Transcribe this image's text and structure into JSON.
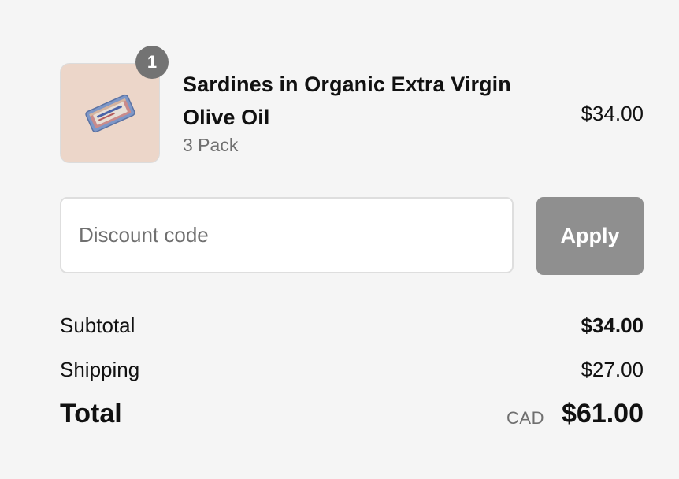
{
  "product": {
    "quantity": "1",
    "title": "Sardines in Organic Extra Virgin Olive Oil",
    "variant": "3 Pack",
    "price": "$34.00",
    "image_icon": "sardine-tin-icon"
  },
  "discount": {
    "placeholder": "Discount code",
    "value": "",
    "apply_label": "Apply"
  },
  "totals": {
    "subtotal_label": "Subtotal",
    "subtotal_value": "$34.00",
    "shipping_label": "Shipping",
    "shipping_value": "$27.00",
    "total_label": "Total",
    "currency": "CAD",
    "total_value": "$61.00"
  },
  "colors": {
    "background": "#f5f5f5",
    "apply_button": "#8f8f8f",
    "badge": "#737373",
    "thumb_bg": "#ecd6c9"
  }
}
